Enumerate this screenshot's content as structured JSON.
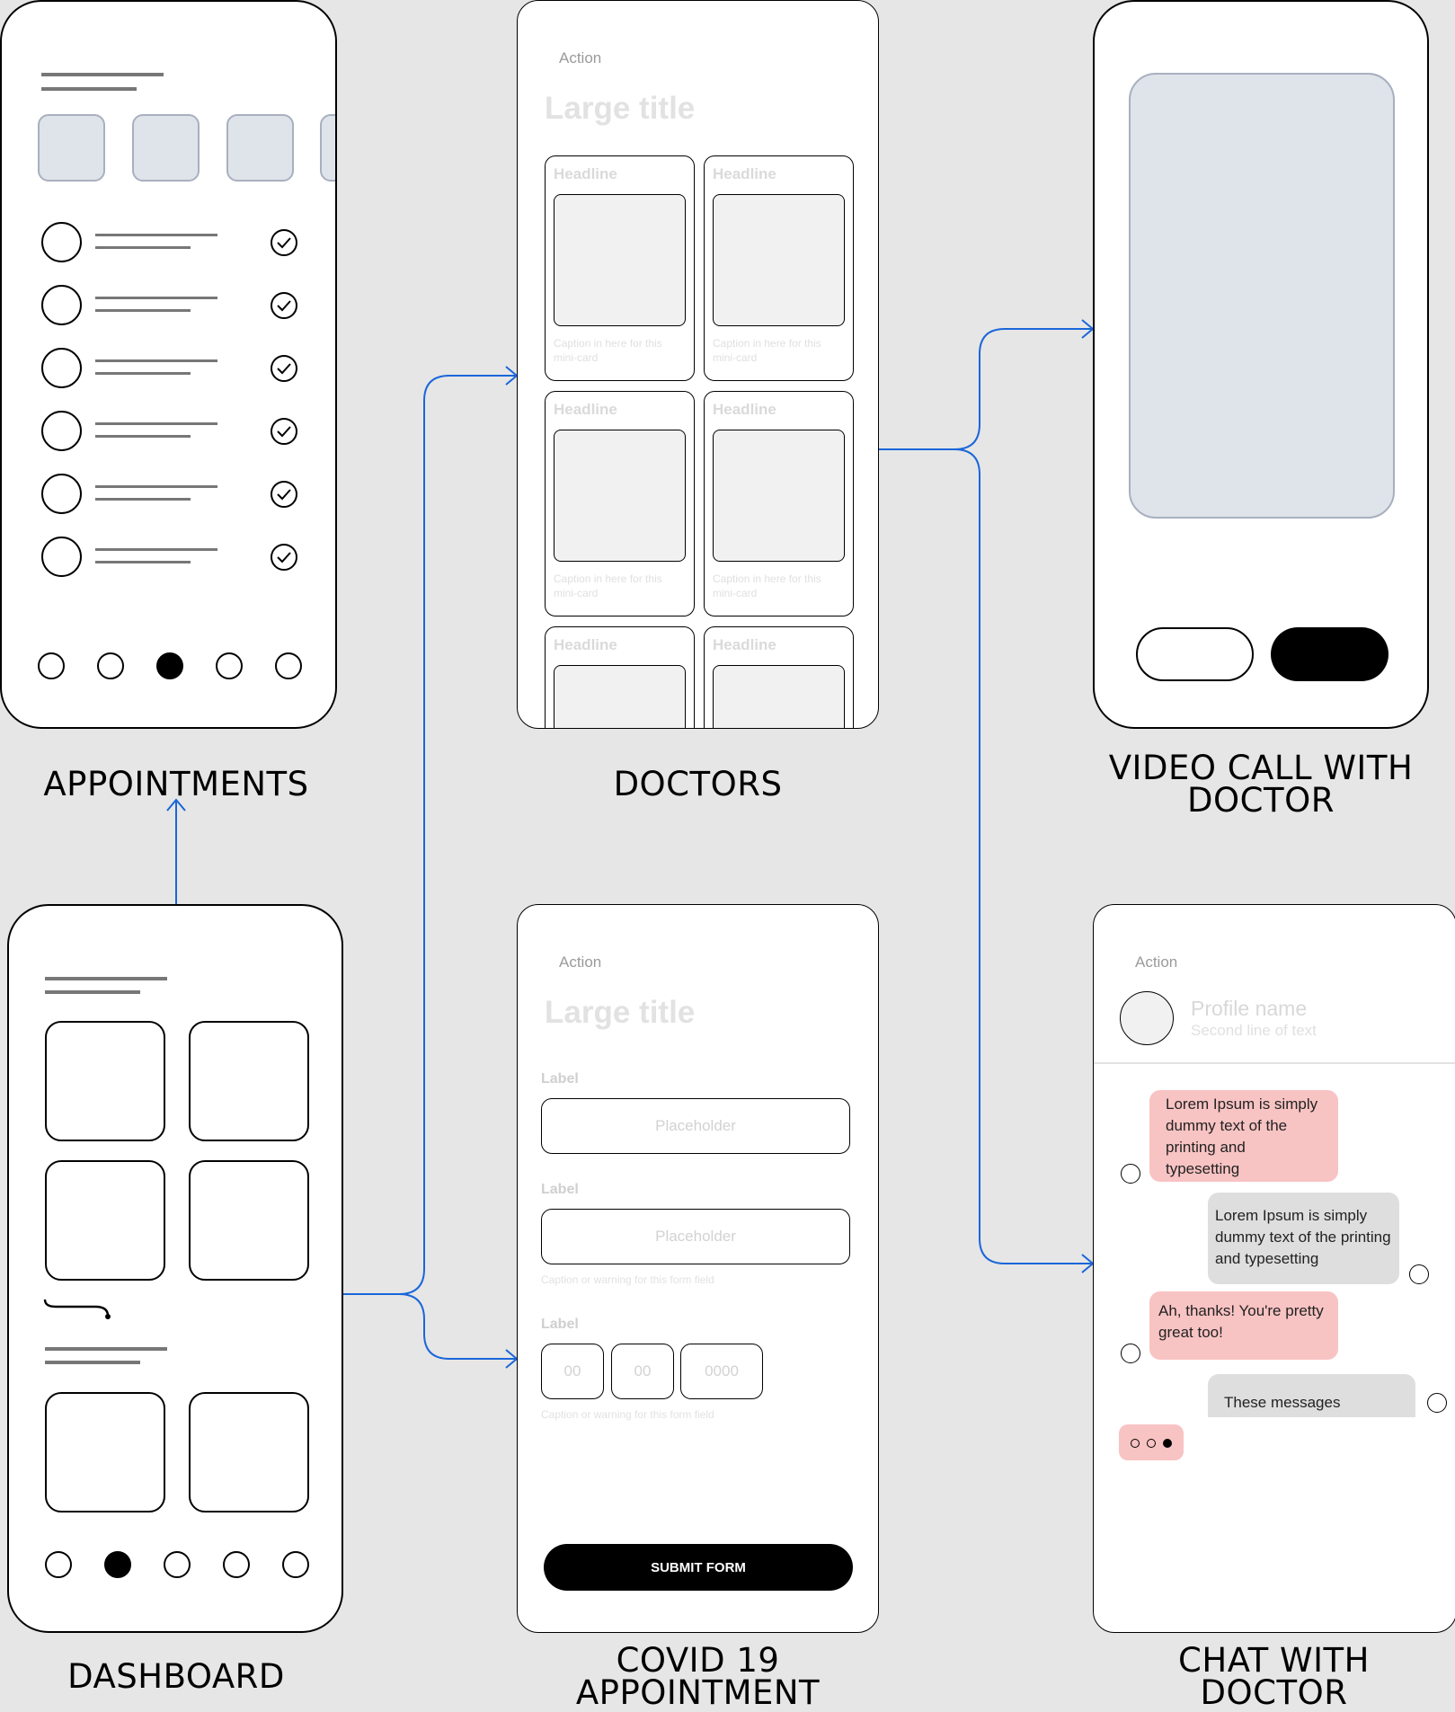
{
  "screens": {
    "appointments": {
      "title": "APPOINTMENTS"
    },
    "doctors": {
      "title": "DOCTORS",
      "action": "Action",
      "large_title": "Large title",
      "cards": [
        {
          "headline": "Headline",
          "caption": "Caption in here for this mini-card"
        },
        {
          "headline": "Headline",
          "caption": "Caption in here for this mini-card"
        },
        {
          "headline": "Headline",
          "caption": "Caption in here for this mini-card"
        },
        {
          "headline": "Headline",
          "caption": "Caption in here for this mini-card"
        },
        {
          "headline": "Headline",
          "caption": ""
        },
        {
          "headline": "Headline",
          "caption": ""
        }
      ]
    },
    "video_call": {
      "title_line1": "VIDEO CALL WITH",
      "title_line2": "DOCTOR"
    },
    "dashboard": {
      "title": "DASHBOARD"
    },
    "covid": {
      "title_line1": "COVID 19",
      "title_line2": "APPOINTMENT",
      "action": "Action",
      "large_title": "Large title",
      "field1": {
        "label": "Label",
        "placeholder": "Placeholder"
      },
      "field2": {
        "label": "Label",
        "placeholder": "Placeholder",
        "caption": "Caption or warning for this form field"
      },
      "field3": {
        "label": "Label",
        "day": "00",
        "month": "00",
        "year": "0000",
        "caption": "Caption or warning for this form field"
      },
      "submit_label": "SUBMIT FORM"
    },
    "chat": {
      "title_line1": "CHAT WITH",
      "title_line2": "DOCTOR",
      "action": "Action",
      "profile_name": "Profile name",
      "profile_sub": "Second line of text",
      "messages": [
        "Lorem Ipsum is simply dummy text of the printing and typesetting",
        "Lorem Ipsum is simply dummy text of the printing and typesetting",
        "Ah, thanks! You're pretty great too!",
        "These messages"
      ]
    }
  },
  "colors": {
    "flow_arrow": "#1a66d9",
    "tile_fill": "#dfe3ea",
    "bubble_pink": "#f8c3c3",
    "bubble_grey": "#dedede"
  },
  "nav": {
    "appointments_active_index": 2,
    "dashboard_active_index": 1
  }
}
